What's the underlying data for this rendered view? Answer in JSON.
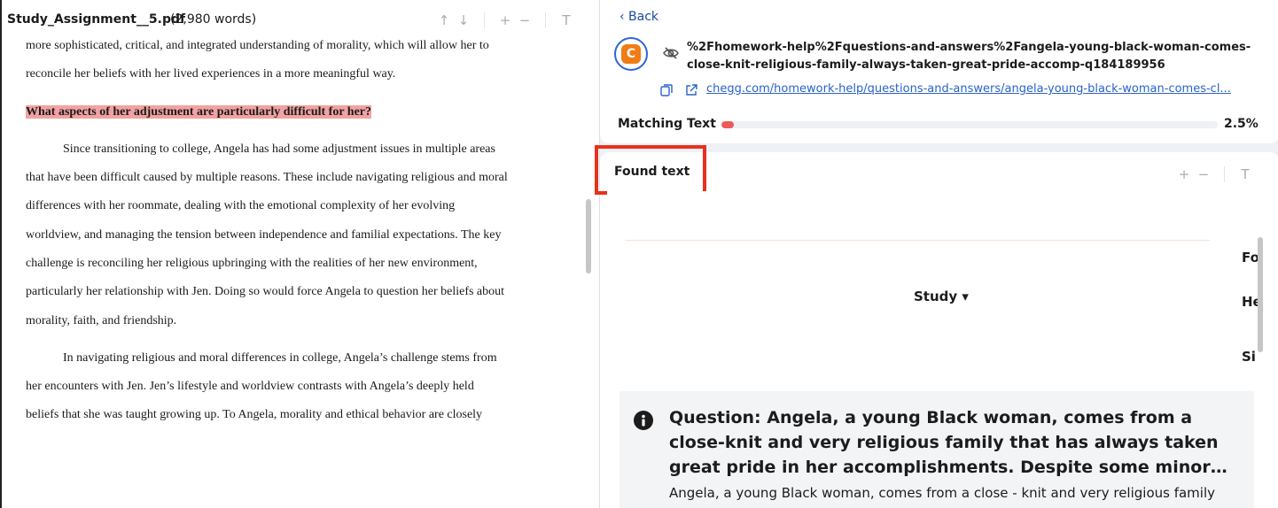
{
  "document": {
    "filename": "Study_Assignment__5.pdf",
    "word_count": "(2,980 words)",
    "toolbar": {
      "up_icon": "↑",
      "down_icon": "↓",
      "zoom_in": "+",
      "zoom_out": "−",
      "text_icon": "T"
    },
    "lines": [
      "more sophisticated, critical, and integrated understanding of morality, which will allow her to",
      "reconcile her beliefs with her lived experiences in a more meaningful way.",
      "What aspects of her adjustment are particularly difficult for her?",
      "Since transitioning to college, Angela has had some adjustment issues in multiple areas",
      "that have been difficult caused by multiple reasons. These include navigating religious and moral",
      "differences with her roommate, dealing with the emotional complexity of her evolving",
      "worldview, and managing the tension between independence and familial expectations. The key",
      "challenge is reconciling her religious upbringing with the realities of her new environment,",
      "particularly her relationship with Jen. Doing so would force Angela to question her beliefs about",
      "morality, faith, and friendship.",
      "In navigating religious and moral differences in college, Angela’s challenge stems from",
      "her encounters with Jen. Jen’s lifestyle and worldview contrasts with Angela’s deeply held",
      "beliefs that she was taught growing up. To Angela, morality and ethical behavior are closely"
    ]
  },
  "match": {
    "back_label": "‹ Back",
    "source_icon_letter": "C",
    "source_title": "%2Fhomework-help%2Fquestions-and-answers%2Fangela-young-black-woman-comes-close-knit-religious-family-always-taken-great-pride-accomp-q184189956",
    "source_url": "chegg.com/homework-help/questions-and-answers/angela-young-black-woman-comes-cl...",
    "matching_label": "Matching Text",
    "matching_percent": "2.5%",
    "matching_fraction": 0.025
  },
  "found": {
    "title": "Found text",
    "toolbar": {
      "zoom_in": "+",
      "zoom_out": "−",
      "text_icon": "T"
    },
    "study_label": "Study ▾",
    "side_cut": [
      "Fo",
      "He",
      "Si"
    ],
    "question_title": "Question: Angela, a young Black woman, comes from a close-knit and very religious family that has always taken great pride in her accomplishments. Despite some minor…",
    "question_body": "Angela, a young Black woman, comes from a close - knit and very religious family"
  },
  "colors": {
    "highlight": "#f2a2a2",
    "link": "#2a63c9",
    "match_bar": "#ea5a5a",
    "callout": "#e8311c",
    "brand_orange": "#f07c15"
  }
}
